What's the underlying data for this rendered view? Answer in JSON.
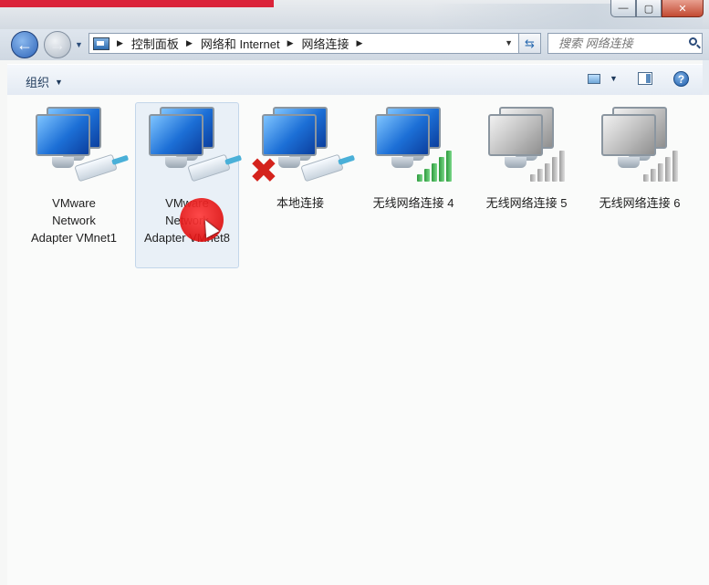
{
  "window": {
    "caption_buttons": [
      "—",
      "▢",
      "✕"
    ]
  },
  "nav": {
    "breadcrumbs": [
      "控制面板",
      "网络和 Internet",
      "网络连接"
    ],
    "search_placeholder": "搜索 网络连接"
  },
  "toolbar": {
    "organize_label": "组织"
  },
  "items": [
    {
      "label": "VMware Network Adapter VMnet1",
      "icon": "network-adapter-icon",
      "status": "connected"
    },
    {
      "label": "VMware Network Adapter VMnet8",
      "icon": "network-adapter-icon",
      "status": "connected",
      "selected": true
    },
    {
      "label": "本地连接",
      "icon": "network-adapter-icon",
      "status": "disconnected"
    },
    {
      "label": "无线网络连接 4",
      "icon": "wireless-adapter-icon",
      "status": "connected"
    },
    {
      "label": "无线网络连接 5",
      "icon": "wireless-adapter-icon",
      "status": "disabled"
    },
    {
      "label": "无线网络连接 6",
      "icon": "wireless-adapter-icon",
      "status": "disabled"
    }
  ],
  "colors": {
    "accent": "#1f5ba8",
    "error": "#d4231c",
    "signal_green": "#2c9a3c",
    "cursor_highlight": "#e00000"
  }
}
